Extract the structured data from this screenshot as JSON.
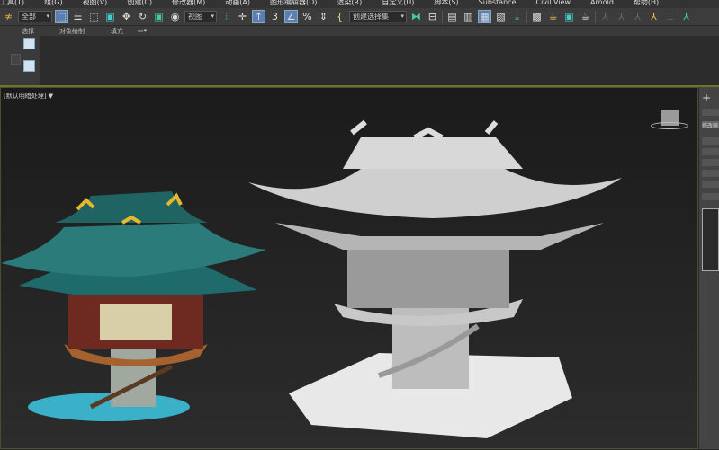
{
  "menu": [
    "工具(T)",
    "组(G)",
    "视图(V)",
    "创建(C)",
    "修改器(M)",
    "动画(A)",
    "图形编辑器(D)",
    "渲染(R)",
    "自定义(U)",
    "脚本(S)",
    "Substance",
    "Civil View",
    "Arnold",
    "帮助(H)"
  ],
  "toolbar": {
    "filter_value": "全部",
    "coord_value": "视图",
    "selection_set_placeholder": "创建选择集"
  },
  "ribbon_tabs": [
    "选择",
    "对象绘制",
    "填充"
  ],
  "viewport": {
    "label": "[默认明暗处理]",
    "filter_icon": "▼"
  },
  "command_panel": {
    "add_label": "+",
    "modifier_list": "修改器"
  },
  "colors": {
    "accent": "#5b7fb5",
    "viewport_border": "#6e7330"
  }
}
